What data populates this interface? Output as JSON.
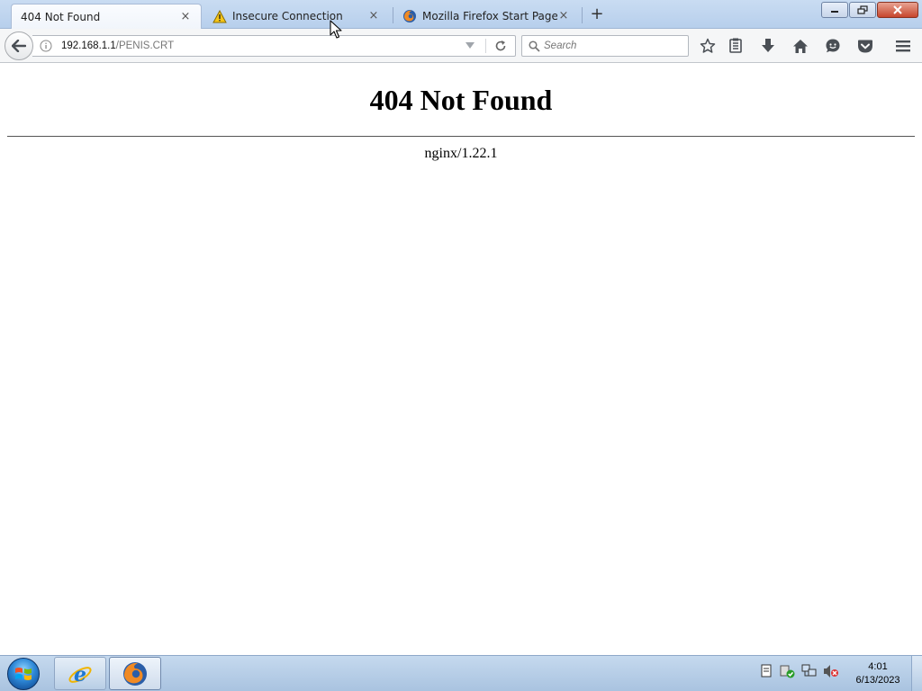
{
  "tabs": [
    {
      "label": "404 Not Found",
      "active": true,
      "icon": "none"
    },
    {
      "label": "Insecure Connection",
      "active": false,
      "icon": "warning-icon"
    },
    {
      "label": "Mozilla Firefox Start Page",
      "active": false,
      "icon": "firefox-icon"
    }
  ],
  "tab_close_glyph": "×",
  "new_tab_glyph": "+",
  "url": {
    "host": "192.168.1.1",
    "path": "/PENIS.CRT"
  },
  "search": {
    "placeholder": "Search"
  },
  "toolbar_icons": [
    "bookmark-star-icon",
    "reading-list-icon",
    "downloads-icon",
    "home-icon",
    "hello-icon",
    "pocket-icon",
    "menu-icon"
  ],
  "page": {
    "title": "404 Not Found",
    "server": "nginx/1.22.1"
  },
  "taskbar": {
    "apps": [
      "internet-explorer-icon",
      "firefox-icon"
    ],
    "clock_time": "4:01",
    "clock_date": "6/13/2023"
  },
  "colors": {
    "tabstrip": "#b7cfec",
    "taskbar": "#a9c3e0",
    "close_button": "#c7452c"
  }
}
